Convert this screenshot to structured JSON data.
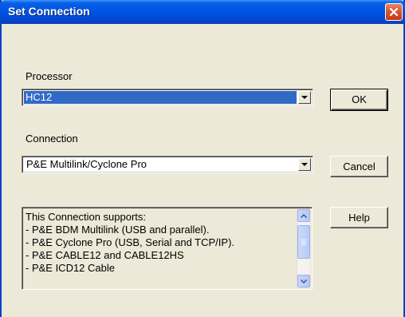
{
  "window": {
    "title": "Set Connection",
    "close_icon": "close-icon"
  },
  "processor": {
    "label": "Processor",
    "value": "HC12"
  },
  "connection": {
    "label": "Connection",
    "value": "P&E Multilink/Cyclone Pro"
  },
  "buttons": {
    "ok": "OK",
    "cancel": "Cancel",
    "help": "Help"
  },
  "info": {
    "lines": [
      "This Connection supports:",
      "- P&E BDM Multilink (USB and parallel).",
      "- P&E Cyclone Pro (USB, Serial and TCP/IP).",
      "- P&E CABLE12 and CABLE12HS",
      "- P&E ICD12 Cable"
    ]
  },
  "colors": {
    "titlebar": "#0055e5",
    "selection": "#316ac5",
    "face": "#ece9d8"
  }
}
